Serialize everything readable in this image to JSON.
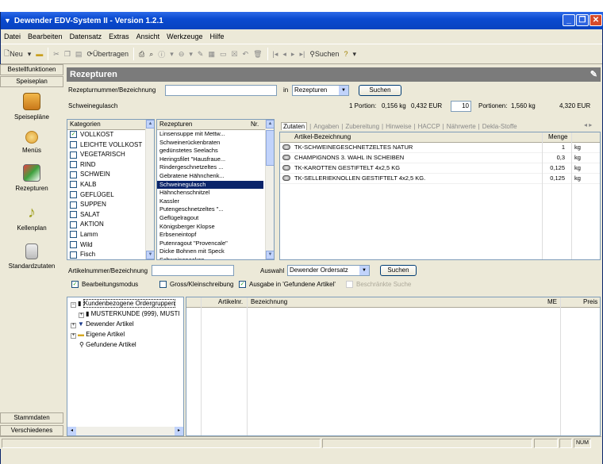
{
  "window": {
    "title": "Dewender EDV-System II - Version 1.2.1"
  },
  "menu": [
    "Datei",
    "Bearbeiten",
    "Datensatz",
    "Extras",
    "Ansicht",
    "Werkzeuge",
    "Hilfe"
  ],
  "toolbar": {
    "new_label": "Neu",
    "transfer_label": "Übertragen",
    "search_label": "Suchen"
  },
  "leftnav": {
    "top_buttons": [
      "Bestellfunktionen",
      "Speiseplan"
    ],
    "items": [
      "Speisepläne",
      "Menüs",
      "Rezepturen",
      "Kellenplan",
      "Standardzutaten"
    ],
    "bottom_buttons": [
      "Stammdaten",
      "Verschiedenes"
    ]
  },
  "panel": {
    "title": "Rezepturen"
  },
  "search": {
    "label": "Rezepturnummer/Bezeichnung",
    "value": "",
    "in_label": "in",
    "scope": "Rezepturen",
    "button": "Suchen"
  },
  "summary": {
    "recipe_name": "Schweinegulasch",
    "portion_label": "1 Portion:",
    "portion_weight": "0,156 kg",
    "portion_price": "0,432 EUR",
    "portions_count": "10",
    "portions_label": "Portionen:",
    "total_weight": "1,560 kg",
    "total_price": "4,320 EUR"
  },
  "categories": {
    "header": "Kategorien",
    "items": [
      {
        "label": "VOLLKOST",
        "checked": true
      },
      {
        "label": "LEICHTE VOLLKOST",
        "checked": false
      },
      {
        "label": "VEGETARISCH",
        "checked": false
      },
      {
        "label": "RIND",
        "checked": false
      },
      {
        "label": "SCHWEIN",
        "checked": false
      },
      {
        "label": "KALB",
        "checked": false
      },
      {
        "label": "GEFLÜGEL",
        "checked": false
      },
      {
        "label": "SUPPEN",
        "checked": false
      },
      {
        "label": "SALAT",
        "checked": false
      },
      {
        "label": "AKTION",
        "checked": false
      },
      {
        "label": "Lamm",
        "checked": false
      },
      {
        "label": "Wild",
        "checked": false
      },
      {
        "label": "Fisch",
        "checked": false
      }
    ]
  },
  "recipes": {
    "header": "Rezepturen",
    "nr_header": "Nr.",
    "items": [
      "Linsensuppe mit Mettw...",
      "Schweinerückenbraten",
      "gedünstetes Seelachs",
      "Heringsfilet \"Hausfraue...",
      "Rindergeschnetzeltes ...",
      "Gebratene Hähnchenk...",
      "Schweinegulasch",
      "Hähnchenschnitzel",
      "Kassler",
      "Putengeschnetzeltes \"...",
      "Geflügelragout",
      "Königsberger Klopse",
      "Erbseneintopf",
      "Putenragout \"Provencale\"",
      "Dicke Bohnen mit Speck",
      "Schweinenacken"
    ],
    "selected_index": 6
  },
  "tabs": [
    "Zutaten",
    "Angaben",
    "Zubereitung",
    "Hinweise",
    "HACCP",
    "Nährwerte",
    "Dekla-Stoffe"
  ],
  "ingredients": {
    "col_name": "Artikel-Bezeichnung",
    "col_qty": "Menge",
    "rows": [
      {
        "name": "TK-SCHWEINEGESCHNETZELTES NATUR",
        "qty": "1",
        "unit": "kg"
      },
      {
        "name": "CHAMPIGNONS 3. WAHL IN SCHEIBEN",
        "qty": "0,3",
        "unit": "kg"
      },
      {
        "name": "TK-KAROTTEN GESTIFTELT 4x2,5 KG",
        "qty": "0,125",
        "unit": "kg"
      },
      {
        "name": "TK-SELLERIEKNOLLEN GESTIFTELT 4x2,5 KG.",
        "qty": "0,125",
        "unit": "kg"
      }
    ]
  },
  "article_search": {
    "label": "Artikelnummer/Bezeichnung",
    "value": "",
    "auswahl_label": "Auswahl",
    "auswahl_value": "Dewender Ordersatz",
    "button": "Suchen",
    "opt_edit": "Bearbeitungsmodus",
    "opt_case": "Gross/Kleinschreibung",
    "opt_output": "Ausgabe in 'Gefundene Artikel'",
    "opt_limited": "Beschränkte Suche"
  },
  "tree": {
    "items": [
      "Kundenbezogene Ordergruppen",
      "MUSTERKUNDE (999), MUSTI",
      "Dewender Artikel",
      "Eigene Artikel",
      "Gefundene Artikel"
    ]
  },
  "result_grid": {
    "col_artnr": "Artikelnr.",
    "col_name": "Bezeichnung",
    "col_me": "ME",
    "col_price": "Preis"
  },
  "status": {
    "num": "NUM"
  }
}
